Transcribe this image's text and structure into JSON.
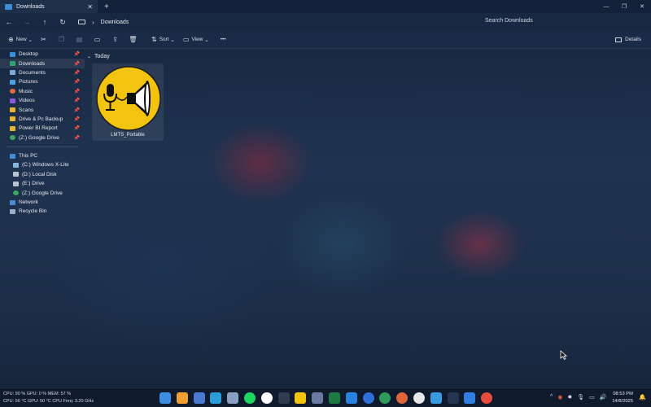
{
  "titlebar": {
    "tab_title": "Downloads",
    "tab_close": "✕",
    "new_tab": "+",
    "window_controls": [
      "—",
      "❐",
      "✕"
    ]
  },
  "addressbar": {
    "back": "←",
    "forward": "→",
    "up": "↑",
    "refresh": "↻",
    "separator": "›",
    "location": "Downloads",
    "search_placeholder": "Search Downloads"
  },
  "toolbar": {
    "new_label": "New",
    "sort_label": "Sort",
    "view_label": "View",
    "more": "•••",
    "details_label": "Details"
  },
  "nav": {
    "quick_access": [
      {
        "label": "Desktop",
        "color": "#3a8fd8"
      },
      {
        "label": "Downloads",
        "color": "#2fa36b"
      },
      {
        "label": "Documents",
        "color": "#7fa9d8"
      },
      {
        "label": "Pictures",
        "color": "#4aa3e0"
      },
      {
        "label": "Music",
        "color": "#e06a3a"
      },
      {
        "label": "Videos",
        "color": "#8a5bd8"
      },
      {
        "label": "Scans",
        "color": "#e8b530"
      },
      {
        "label": "Drive & Pc Backup",
        "color": "#e8b530"
      },
      {
        "label": "Power BI Report",
        "color": "#e8b530"
      },
      {
        "label": "(Z:) Google Drive",
        "color": "#3aa860"
      }
    ],
    "this_pc": "This PC",
    "drives": [
      {
        "label": "(C:) Windows X-Lite",
        "color": "#8ab4e0"
      },
      {
        "label": "(D:) Local Disk",
        "color": "#b8c2d0"
      },
      {
        "label": "(E:) Drive",
        "color": "#b8c2d0"
      },
      {
        "label": "(Z:) Google Drive",
        "color": "#3aa860"
      }
    ],
    "network": "Network",
    "recycle_bin": "Recycle Bin"
  },
  "content": {
    "group_label": "Today",
    "file": {
      "name": "LMTS_Portable",
      "icon": "microphone-speaker-icon",
      "icon_bg": "#f2c40f"
    }
  },
  "taskbar": {
    "stats_line1": "CPU: 90 %    GPU: 0 %      MEM: 57 %",
    "stats_line2": "CPU: 56 °C   GPU: 50 °C   CPU Freq: 3.20 GHz",
    "pinned_colors": [
      "#3d8de0",
      "#f0a030",
      "#4a7ad0",
      "#2d9bd8",
      "#8aa0c0",
      "#1ed760",
      "#ffffff",
      "#2f3b4f",
      "#f2c40f",
      "#6a7aa0",
      "#1d7a44",
      "#2a82e0",
      "#2f6fd6",
      "#2e9c5a",
      "#e0663a",
      "#e8e8e8",
      "#3a9ae0",
      "#24354f",
      "#2f7ee0",
      "#e84c3d"
    ],
    "tray_icons": [
      "^",
      "◉",
      "✹",
      "🎙",
      "▭",
      "🔊"
    ],
    "time": "08:53 PM",
    "date": "14/8/2025",
    "bell": "🔔"
  }
}
